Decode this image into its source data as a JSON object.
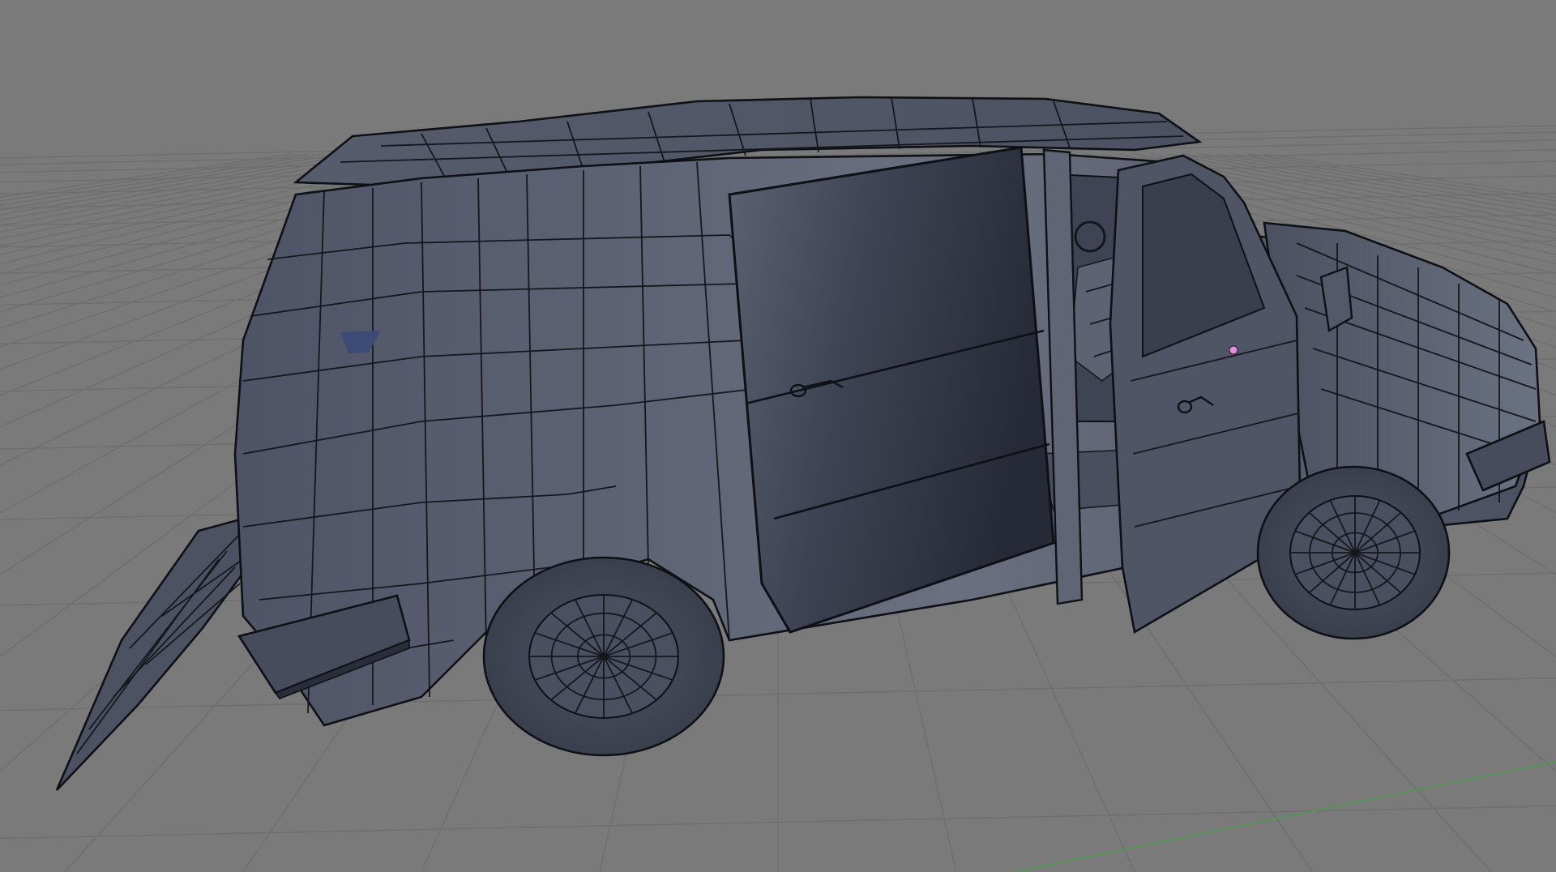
{
  "viewport": {
    "mode": "3d-viewport",
    "shading": "solid",
    "overlay": "wireframe",
    "background_color": "#7a7a7a",
    "grid_color": "#6e6e6e",
    "axis_y_color": "#4f9a4f",
    "mesh_color": "#5a6070",
    "edge_color": "#15171d",
    "selected_vertex_color": "#e58fe0",
    "object": {
      "icon": "van-mesh-icon",
      "parts": [
        "body",
        "sliding-door",
        "front-door",
        "rear-hatch",
        "rear-wheel",
        "front-wheel",
        "rear-bumper",
        "front-bumper",
        "side-mirror",
        "roof",
        "door-handle-sliding",
        "door-handle-front",
        "steering-wheel",
        "seat"
      ]
    }
  }
}
